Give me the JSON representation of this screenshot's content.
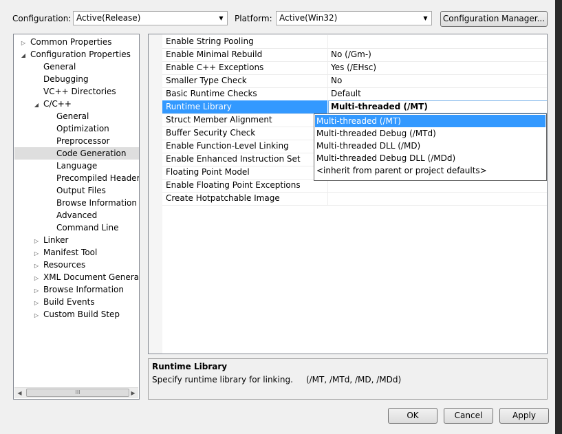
{
  "toolbar": {
    "configuration_label": "Configuration:",
    "configuration_value": "Active(Release)",
    "platform_label": "Platform:",
    "platform_value": "Active(Win32)",
    "config_manager_button": "Configuration Manager..."
  },
  "tree": {
    "items": [
      {
        "label": "Common Properties",
        "expander": "▷"
      },
      {
        "label": "Configuration Properties",
        "expander": "◢"
      },
      {
        "label": "General",
        "expander": ""
      },
      {
        "label": "Debugging",
        "expander": ""
      },
      {
        "label": "VC++ Directories",
        "expander": ""
      },
      {
        "label": "C/C++",
        "expander": "◢"
      },
      {
        "label": "General",
        "expander": ""
      },
      {
        "label": "Optimization",
        "expander": ""
      },
      {
        "label": "Preprocessor",
        "expander": ""
      },
      {
        "label": "Code Generation",
        "expander": ""
      },
      {
        "label": "Language",
        "expander": ""
      },
      {
        "label": "Precompiled Headers",
        "expander": ""
      },
      {
        "label": "Output Files",
        "expander": ""
      },
      {
        "label": "Browse Information",
        "expander": ""
      },
      {
        "label": "Advanced",
        "expander": ""
      },
      {
        "label": "Command Line",
        "expander": ""
      },
      {
        "label": "Linker",
        "expander": "▷"
      },
      {
        "label": "Manifest Tool",
        "expander": "▷"
      },
      {
        "label": "Resources",
        "expander": "▷"
      },
      {
        "label": "XML Document Generator",
        "expander": "▷"
      },
      {
        "label": "Browse Information",
        "expander": "▷"
      },
      {
        "label": "Build Events",
        "expander": "▷"
      },
      {
        "label": "Custom Build Step",
        "expander": "▷"
      }
    ],
    "selected_item": "Code Generation",
    "scroll_thumb_grip": "III"
  },
  "properties": [
    {
      "name": "Enable String Pooling",
      "value": ""
    },
    {
      "name": "Enable Minimal Rebuild",
      "value": "No (/Gm-)"
    },
    {
      "name": "Enable C++ Exceptions",
      "value": "Yes (/EHsc)"
    },
    {
      "name": "Smaller Type Check",
      "value": "No"
    },
    {
      "name": "Basic Runtime Checks",
      "value": "Default"
    },
    {
      "name": "Runtime Library",
      "value": "Multi-threaded (/MT)"
    },
    {
      "name": "Struct Member Alignment",
      "value": ""
    },
    {
      "name": "Buffer Security Check",
      "value": ""
    },
    {
      "name": "Enable Function-Level Linking",
      "value": ""
    },
    {
      "name": "Enable Enhanced Instruction Set",
      "value": ""
    },
    {
      "name": "Floating Point Model",
      "value": ""
    },
    {
      "name": "Enable Floating Point Exceptions",
      "value": ""
    },
    {
      "name": "Create Hotpatchable Image",
      "value": ""
    }
  ],
  "selected_property": "Runtime Library",
  "dropdown": {
    "options": [
      "Multi-threaded (/MT)",
      "Multi-threaded Debug (/MTd)",
      "Multi-threaded DLL (/MD)",
      "Multi-threaded Debug DLL (/MDd)",
      "<inherit from parent or project defaults>"
    ],
    "highlighted": "Multi-threaded (/MT)"
  },
  "description": {
    "title": "Runtime Library",
    "text": "Specify runtime library for linking.     (/MT, /MTd, /MD, /MDd)"
  },
  "buttons": {
    "ok": "OK",
    "cancel": "Cancel",
    "apply": "Apply"
  },
  "colors": {
    "selection": "#3399ff",
    "tree_selection": "#dedede",
    "dialog_bg": "#f0f0f0"
  }
}
